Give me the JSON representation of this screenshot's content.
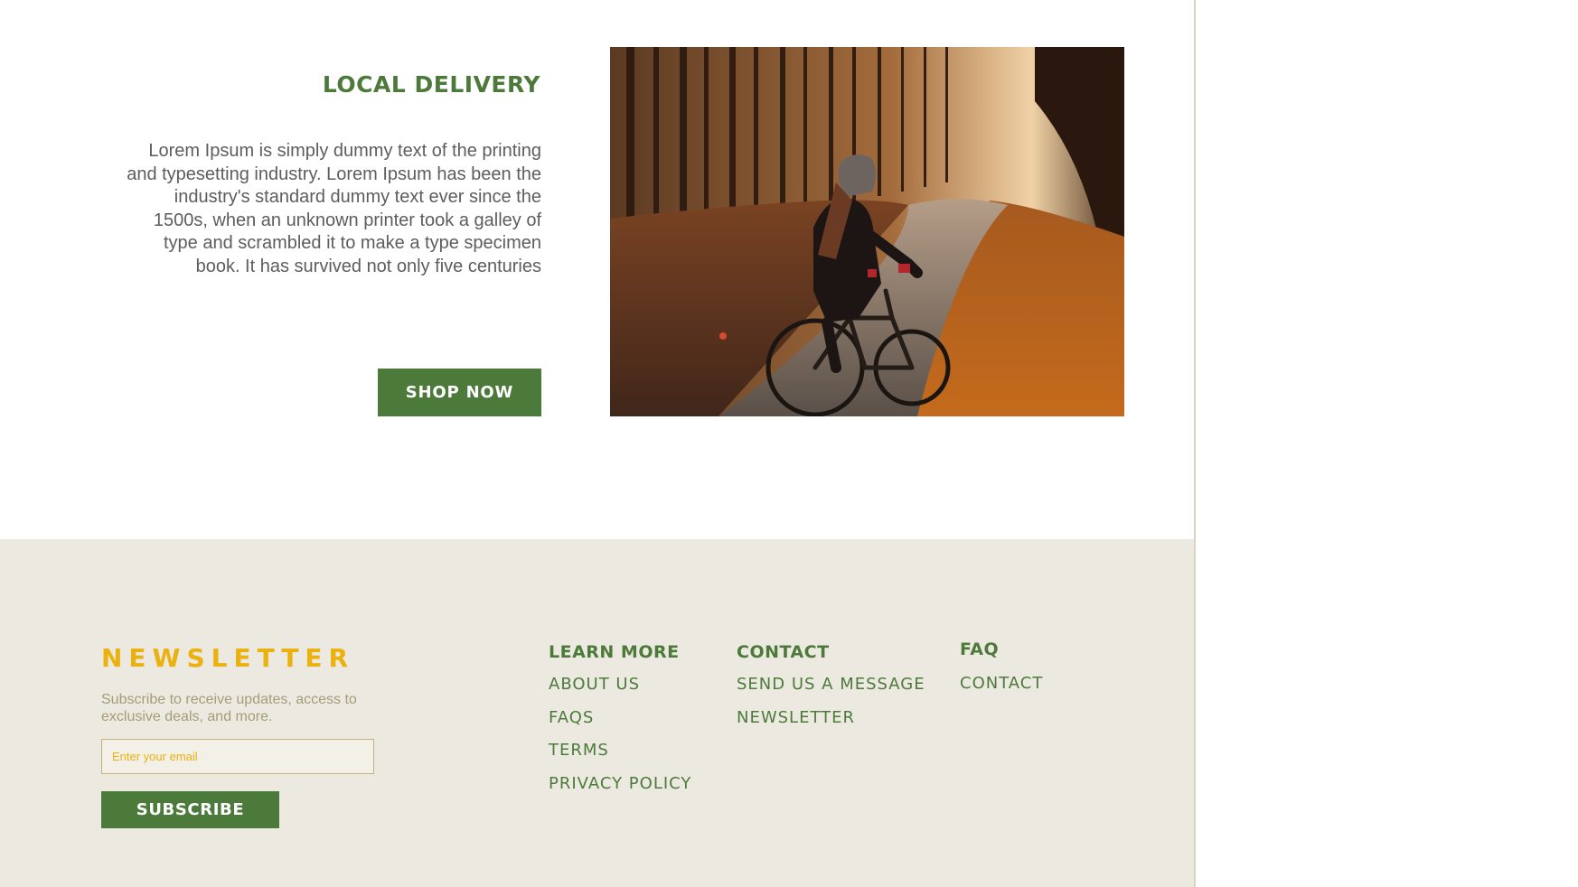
{
  "hero": {
    "title": "LOCAL DELIVERY",
    "body": "Lorem Ipsum is simply dummy text of the printing and typesetting industry. Lorem Ipsum has been the industry's standard dummy text ever since the 1500s, when an unknown printer took a galley of type and scrambled it to make a type specimen book. It has survived not only five centuries",
    "button_label": "SHOP NOW"
  },
  "footer": {
    "newsletter": {
      "title": "NEWSLETTER",
      "description": "Subscribe to receive updates, access to exclusive deals, and more.",
      "email_placeholder": "Enter your email",
      "subscribe_label": "SUBSCRIBE"
    },
    "learn_more": {
      "heading": "LEARN MORE",
      "links": [
        "ABOUT US",
        "FAQS",
        "TERMS",
        "PRIVACY POLICY"
      ]
    },
    "contact": {
      "heading": "CONTACT",
      "links": [
        "SEND US A MESSAGE",
        "NEWSLETTER"
      ]
    },
    "faq": {
      "heading": "FAQ",
      "links": [
        "CONTACT"
      ]
    }
  },
  "colors": {
    "brand_green": "#4b7a3b",
    "accent_yellow": "#ebb10f",
    "footer_bg": "#ece9e0",
    "body_text": "#5d5d5d"
  }
}
